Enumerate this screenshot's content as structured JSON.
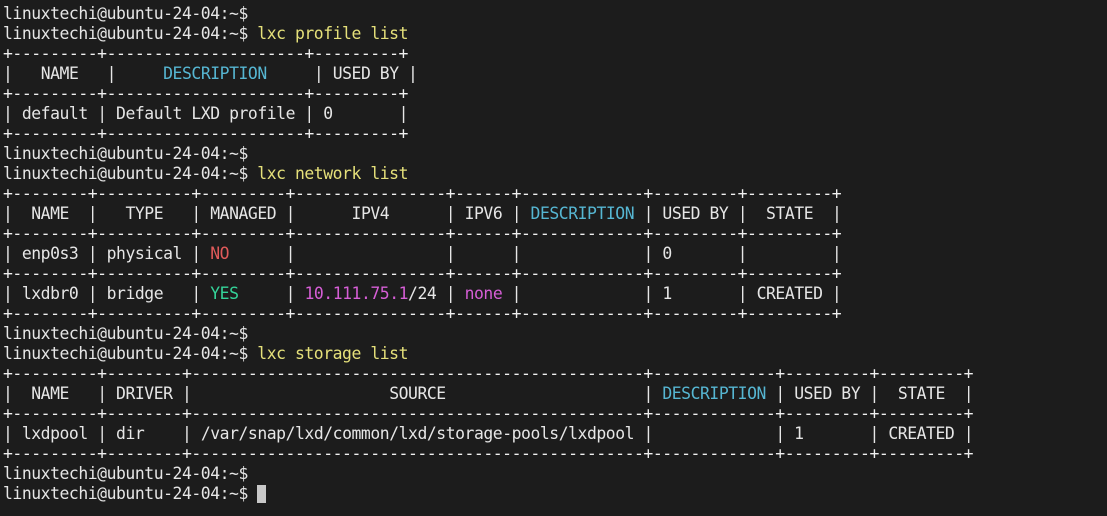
{
  "colors": {
    "background": "#1c1c1c",
    "text": "#e6e6e6",
    "command": "#e5e07a",
    "header_description": "#56b6d2",
    "managed_no": "#e05a5a",
    "managed_yes": "#34d399",
    "ip_value": "#d65ed6"
  },
  "prompt": "linuxtechi@ubuntu-24-04:~$",
  "commands": {
    "profile": "lxc profile list",
    "network": "lxc network list",
    "storage": "lxc storage list"
  },
  "profile_table": {
    "border": "+---------+---------------------+---------+",
    "headers": [
      "NAME",
      "DESCRIPTION",
      "USED BY"
    ],
    "rows": [
      [
        "default",
        "Default LXD profile",
        "0"
      ]
    ]
  },
  "network_table": {
    "border": "+--------+----------+---------+----------------+------+-------------+---------+---------+",
    "headers": [
      "NAME",
      "TYPE",
      "MANAGED",
      "IPV4",
      "IPV6",
      "DESCRIPTION",
      "USED BY",
      "STATE"
    ],
    "rows": [
      {
        "name": "enp0s3",
        "type": "physical",
        "managed": "NO",
        "ipv4_addr": "",
        "ipv4_mask": "",
        "ipv6": "",
        "description": "",
        "used_by": "0",
        "state": ""
      },
      {
        "name": "lxdbr0",
        "type": "bridge",
        "managed": "YES",
        "ipv4_addr": "10.111.75.1",
        "ipv4_mask": "/24",
        "ipv6": "none",
        "description": "",
        "used_by": "1",
        "state": "CREATED"
      }
    ]
  },
  "storage_table": {
    "border": "+---------+--------+------------------------------------------------+-------------+---------+---------+",
    "headers": [
      "NAME",
      "DRIVER",
      "SOURCE",
      "DESCRIPTION",
      "USED BY",
      "STATE"
    ],
    "rows": [
      {
        "name": "lxdpool",
        "driver": "dir",
        "source": "/var/snap/lxd/common/lxd/storage-pools/lxdpool",
        "description": "",
        "used_by": "1",
        "state": "CREATED"
      }
    ]
  }
}
